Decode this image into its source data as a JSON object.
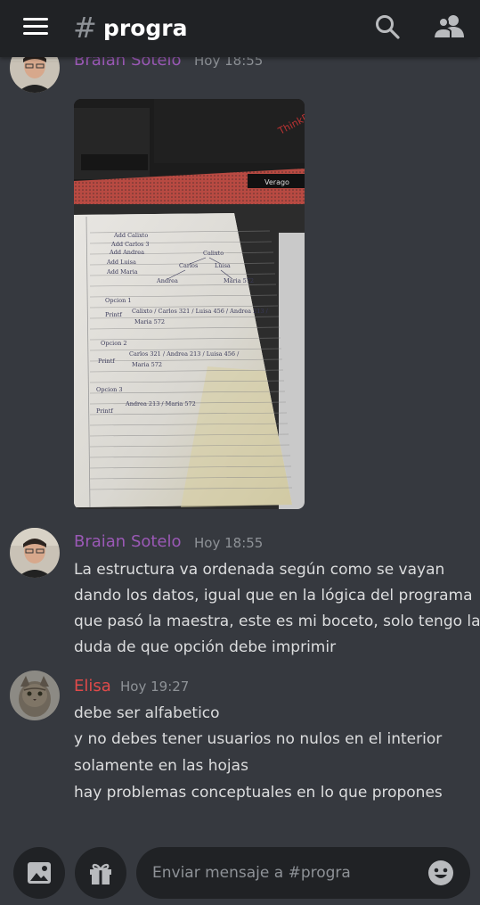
{
  "header": {
    "channel_hash": "#",
    "channel_name": "progra"
  },
  "icons": {
    "menu": "hamburger-icon",
    "search": "search-icon",
    "members": "members-icon",
    "image": "image-icon",
    "gift": "gift-icon",
    "emoji": "emoji-icon"
  },
  "colors": {
    "header_bg": "#202225",
    "chat_bg": "#36393f",
    "braian_name": "#9b59b6",
    "elisa_name": "#e04a4a",
    "timestamp": "#8e9297"
  },
  "messages": [
    {
      "author": "Braian Sotelo",
      "time": "Hoy 18:55",
      "attachment": "notebook-photo",
      "attachment_text": {
        "brand": "ThinkPad",
        "keyboard_brand": "Verago",
        "note_lines": [
          "Add Calixto",
          "Add Carlos 3",
          "Add Andrea",
          "Add Luisa",
          "Add Maria",
          "Calixto",
          "Carlos",
          "Andrea",
          "Maria",
          "Luisa",
          "Opcion 1",
          "Calixto / Carlos 321 / Luisa 456 / Andrea 213 /",
          "Maria 572",
          "Opcion 2",
          "Carlos 321 / Andrea 213 / Luisa 456 /",
          "Maria 572",
          "Opcion 3",
          "Andrea 213 / Maria 572",
          "Printf"
        ]
      }
    },
    {
      "author": "Braian Sotelo",
      "time": "Hoy 18:55",
      "lines": [
        "La estructura va ordenada según como se vayan",
        "dando los datos, igual que en la lógica del programa",
        "que pasó la maestra, este es mi boceto, solo tengo la",
        "duda de que opción debe imprimir"
      ]
    },
    {
      "author": "Elisa",
      "time": "Hoy 19:27",
      "lines": [
        "debe ser alfabetico",
        "y no debes tener usuarios no nulos en el interior",
        "solamente en las hojas",
        "hay problemas conceptuales en lo que propones"
      ]
    }
  ],
  "composer": {
    "placeholder": "Enviar mensaje a #progra"
  }
}
